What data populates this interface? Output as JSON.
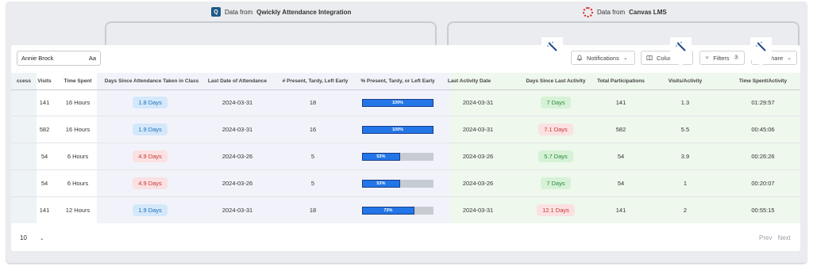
{
  "sources": {
    "qwickly": {
      "prefix": "Data from",
      "name": "Qwickly Attendance Integration",
      "logo": "Q"
    },
    "canvas": {
      "prefix": "Data from",
      "name": "Canvas LMS"
    }
  },
  "toolbar": {
    "search_value": "Annie Brock",
    "search_case_label": "Aa",
    "notifications_label": "Notifications",
    "columns_label": "Columns",
    "filters_label": "Filters",
    "filters_count": "3",
    "share_label": "Share"
  },
  "table": {
    "headers": [
      "ccess",
      "Visits",
      "Time Spent",
      "Days Since Attendance Taken in Class",
      "Last Date of Attendance",
      "# Present, Tardy, Left Early",
      "% Present, Tardy, or Left Early",
      "Last Activity Date",
      "Days Since Last Activity",
      "Total Participations",
      "Visits/Activity",
      "Time Spent/Activity"
    ],
    "rows": [
      {
        "visits": "141",
        "time_spent": "16 Hours",
        "days_since_att": "1.8 Days",
        "last_att": "2024-03-31",
        "ptl": "18",
        "pct": 100,
        "pct_label": "100%",
        "last_act": "2024-03-31",
        "days_since_act": "7 Days",
        "total_part": "141",
        "visits_act": "1.3",
        "time_act": "01:29:57"
      },
      {
        "visits": "582",
        "time_spent": "16 Hours",
        "days_since_att": "1.9 Days",
        "last_att": "2024-03-31",
        "ptl": "16",
        "pct": 100,
        "pct_label": "100%",
        "last_act": "2024-03-31",
        "days_since_act": "7.1 Days",
        "total_part": "582",
        "visits_act": "5.5",
        "time_act": "00:45:06"
      },
      {
        "visits": "54",
        "time_spent": "6 Hours",
        "days_since_att": "4.9 Days",
        "last_att": "2024-03-26",
        "ptl": "5",
        "pct": 53,
        "pct_label": "53%",
        "last_act": "2024-03-26",
        "days_since_act": "5.7 Days",
        "total_part": "54",
        "visits_act": "3.9",
        "time_act": "00:26:26"
      },
      {
        "visits": "54",
        "time_spent": "6 Hours",
        "days_since_att": "4.9 Days",
        "last_att": "2024-03-26",
        "ptl": "5",
        "pct": 53,
        "pct_label": "53%",
        "last_act": "2024-03-26",
        "days_since_act": "7 Days",
        "total_part": "54",
        "visits_act": "1",
        "time_act": "00:20:07"
      },
      {
        "visits": "141",
        "time_spent": "12 Hours",
        "days_since_att": "1.9 Days",
        "last_att": "2024-03-31",
        "ptl": "18",
        "pct": 73,
        "pct_label": "73%",
        "last_act": "2024-03-31",
        "days_since_act": "12.1 Days",
        "total_part": "141",
        "visits_act": "2",
        "time_act": "00:55:15"
      }
    ]
  },
  "pager": {
    "page_size": "10",
    "prev_label": "Prev",
    "next_label": "Next"
  },
  "colors": {
    "accent": "#2276e8",
    "qwickly": "#1f5a86",
    "canvas": "#d12b2b"
  }
}
